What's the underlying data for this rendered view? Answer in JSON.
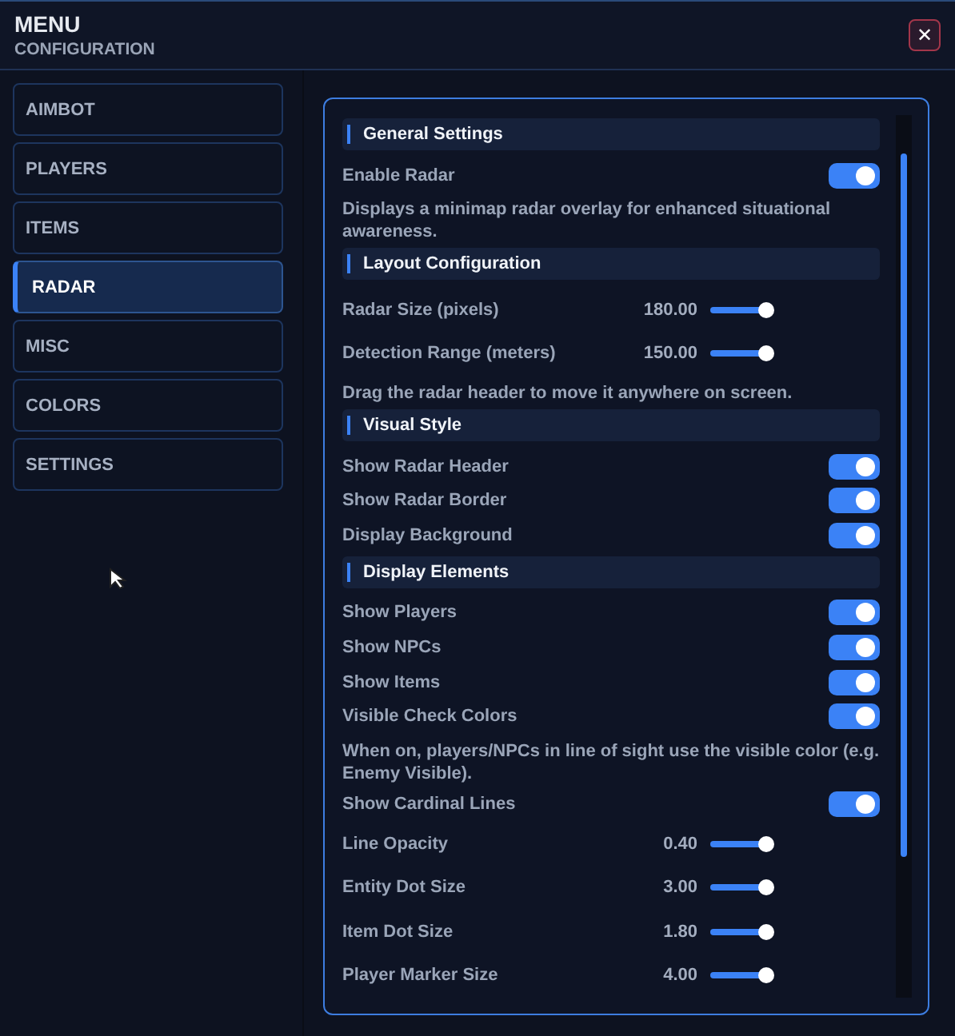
{
  "header": {
    "title": "MENU",
    "subtitle": "CONFIGURATION",
    "close": "✕"
  },
  "sidebar": {
    "items": [
      {
        "label": "AIMBOT",
        "selected": false
      },
      {
        "label": "PLAYERS",
        "selected": false
      },
      {
        "label": "ITEMS",
        "selected": false
      },
      {
        "label": "RADAR",
        "selected": true
      },
      {
        "label": "MISC",
        "selected": false
      },
      {
        "label": "COLORS",
        "selected": false
      },
      {
        "label": "SETTINGS",
        "selected": false
      }
    ]
  },
  "settings": [
    {
      "kind": "section",
      "label": "General Settings"
    },
    {
      "kind": "toggle",
      "label": "Enable Radar",
      "on": true
    },
    {
      "kind": "note",
      "text": "Displays a minimap radar overlay for enhanced situational awareness."
    },
    {
      "kind": "section",
      "label": "Layout Configuration"
    },
    {
      "kind": "slider",
      "label": "Radar Size (pixels)",
      "reading": "180.00"
    },
    {
      "kind": "slider",
      "label": "Detection Range (meters)",
      "reading": "150.00"
    },
    {
      "kind": "note",
      "text": "Drag the radar header to move it anywhere on screen."
    },
    {
      "kind": "section",
      "label": "Visual Style"
    },
    {
      "kind": "toggle",
      "label": "Show Radar Header",
      "on": true
    },
    {
      "kind": "toggle",
      "label": "Show Radar Border",
      "on": true
    },
    {
      "kind": "toggle",
      "label": "Display Background",
      "on": true
    },
    {
      "kind": "section",
      "label": "Display Elements"
    },
    {
      "kind": "toggle",
      "label": "Show Players",
      "on": true
    },
    {
      "kind": "toggle",
      "label": "Show NPCs",
      "on": true
    },
    {
      "kind": "toggle",
      "label": "Show Items",
      "on": true
    },
    {
      "kind": "toggle",
      "label": "Visible Check Colors",
      "on": true
    },
    {
      "kind": "note",
      "text": "When on, players/NPCs in line of sight use the visible color (e.g. Enemy Visible)."
    },
    {
      "kind": "toggle",
      "label": "Show Cardinal Lines",
      "on": true
    },
    {
      "kind": "slider",
      "label": "Line Opacity",
      "reading": "0.40"
    },
    {
      "kind": "slider",
      "label": "Entity Dot Size",
      "reading": "3.00"
    },
    {
      "kind": "slider",
      "label": "Item Dot Size",
      "reading": "1.80"
    },
    {
      "kind": "slider",
      "label": "Player Marker Size",
      "reading": "4.00"
    }
  ]
}
